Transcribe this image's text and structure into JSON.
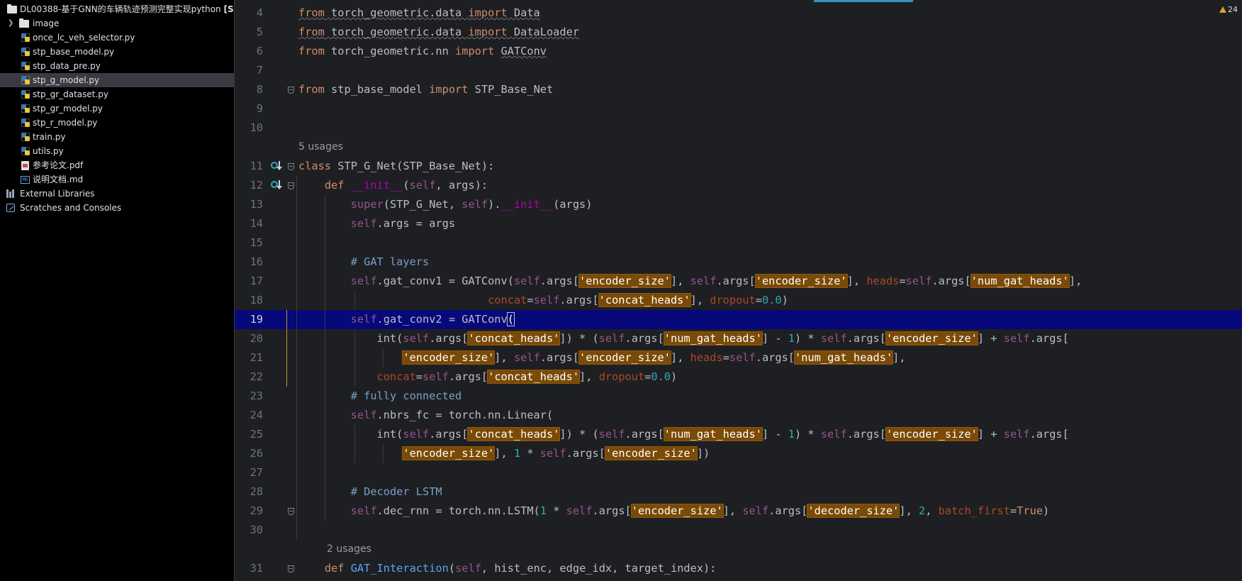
{
  "project_tree": {
    "root": {
      "label": "DL00388-基于GNN的车辆轨迹预测完整实现python",
      "tag": "[SA"
    },
    "items": [
      {
        "label": "image",
        "type": "folder"
      },
      {
        "label": "once_lc_veh_selector.py",
        "type": "py"
      },
      {
        "label": "stp_base_model.py",
        "type": "py"
      },
      {
        "label": "stp_data_pre.py",
        "type": "py"
      },
      {
        "label": "stp_g_model.py",
        "type": "py",
        "selected": true
      },
      {
        "label": "stp_gr_dataset.py",
        "type": "py"
      },
      {
        "label": "stp_gr_model.py",
        "type": "py"
      },
      {
        "label": "stp_r_model.py",
        "type": "py"
      },
      {
        "label": "train.py",
        "type": "py"
      },
      {
        "label": "utils.py",
        "type": "py"
      },
      {
        "label": "参考论文.pdf",
        "type": "pdf"
      },
      {
        "label": "说明文档.md",
        "type": "md"
      }
    ],
    "external_libraries": "External Libraries",
    "scratches": "Scratches and Consoles"
  },
  "editor": {
    "warnings_count": "24",
    "usages_class": "5 usages",
    "usages_method": "2 usages",
    "current_line": 19,
    "lines": [
      {
        "n": "4",
        "t": [
          [
            "kw wavy",
            "from"
          ],
          [
            "wavy",
            " torch_geometric.data "
          ],
          [
            "kw wavy",
            "import"
          ],
          [
            "wavy",
            " Data"
          ]
        ]
      },
      {
        "n": "5",
        "t": [
          [
            "kw wavy",
            "from"
          ],
          [
            "wavy",
            " torch_geometric.data "
          ],
          [
            "kw wavy",
            "import"
          ],
          [
            "wavy",
            " DataLoader"
          ]
        ]
      },
      {
        "n": "6",
        "t": [
          [
            "kw",
            "from"
          ],
          [
            "",
            " torch_geometric.nn "
          ],
          [
            "kw",
            "import"
          ],
          [
            "",
            " "
          ],
          [
            "wavy",
            "GATConv"
          ]
        ]
      },
      {
        "n": "7",
        "t": []
      },
      {
        "n": "8",
        "t": [
          [
            "kw",
            "from"
          ],
          [
            "",
            " stp_base_model "
          ],
          [
            "kw",
            "import"
          ],
          [
            "",
            " STP_Base_Net"
          ]
        ]
      },
      {
        "n": "9",
        "t": []
      },
      {
        "n": "10",
        "t": []
      },
      {
        "n": "11",
        "t": [
          [
            "kw",
            "class"
          ],
          [
            "",
            " STP_G_Net(STP_Base_Net):"
          ]
        ]
      },
      {
        "n": "12",
        "t": [
          [
            "",
            "    "
          ],
          [
            "kw",
            "def"
          ],
          [
            "",
            " "
          ],
          [
            "dd",
            "__init__"
          ],
          [
            "",
            "("
          ],
          [
            "sf",
            "self"
          ],
          [
            "",
            ", args):"
          ]
        ]
      },
      {
        "n": "13",
        "t": [
          [
            "",
            "        "
          ],
          [
            "sf",
            "super"
          ],
          [
            "",
            "(STP_G_Net, "
          ],
          [
            "sf",
            "self"
          ],
          [
            "",
            ")."
          ],
          [
            "dd",
            "__init__"
          ],
          [
            "",
            "(args)"
          ]
        ]
      },
      {
        "n": "14",
        "t": [
          [
            "",
            "        "
          ],
          [
            "sf",
            "self"
          ],
          [
            "",
            ".args = args"
          ]
        ]
      },
      {
        "n": "15",
        "t": []
      },
      {
        "n": "16",
        "t": [
          [
            "",
            "        "
          ],
          [
            "cm",
            "# GAT layers"
          ]
        ]
      },
      {
        "n": "17",
        "t": [
          [
            "",
            "        "
          ],
          [
            "sf",
            "self"
          ],
          [
            "",
            ".gat_conv1 = GATConv("
          ],
          [
            "sf",
            "self"
          ],
          [
            "",
            ".args["
          ],
          [
            "st",
            "'encoder_size'"
          ],
          [
            "",
            "], "
          ],
          [
            "sf",
            "self"
          ],
          [
            "",
            ".args["
          ],
          [
            "st",
            "'encoder_size'"
          ],
          [
            "",
            "], "
          ],
          [
            "pr",
            "heads"
          ],
          [
            "",
            "="
          ],
          [
            "sf",
            "self"
          ],
          [
            "",
            ".args["
          ],
          [
            "st",
            "'num_gat_heads'"
          ],
          [
            "",
            "],"
          ]
        ]
      },
      {
        "n": "18",
        "t": [
          [
            "",
            "                             "
          ],
          [
            "pr",
            "concat"
          ],
          [
            "",
            "="
          ],
          [
            "sf",
            "self"
          ],
          [
            "",
            ".args["
          ],
          [
            "st",
            "'concat_heads'"
          ],
          [
            "",
            "], "
          ],
          [
            "pr",
            "dropout"
          ],
          [
            "",
            "="
          ],
          [
            "nm",
            "0.0"
          ],
          [
            "",
            ")"
          ]
        ]
      },
      {
        "n": "19",
        "t": [
          [
            "",
            "        "
          ],
          [
            "sf",
            "self"
          ],
          [
            "",
            ".gat_conv2 = GATConv"
          ],
          [
            "bracket-match",
            "("
          ]
        ]
      },
      {
        "n": "20",
        "t": [
          [
            "",
            "            int("
          ],
          [
            "sf",
            "self"
          ],
          [
            "",
            ".args["
          ],
          [
            "st",
            "'concat_heads'"
          ],
          [
            "",
            "]) * ("
          ],
          [
            "sf",
            "self"
          ],
          [
            "",
            ".args["
          ],
          [
            "st",
            "'num_gat_heads'"
          ],
          [
            "",
            "] - "
          ],
          [
            "nm",
            "1"
          ],
          [
            "",
            ") * "
          ],
          [
            "sf",
            "self"
          ],
          [
            "",
            ".args["
          ],
          [
            "st",
            "'encoder_size'"
          ],
          [
            "",
            "] + "
          ],
          [
            "sf",
            "self"
          ],
          [
            "",
            ".args["
          ]
        ]
      },
      {
        "n": "21",
        "t": [
          [
            "",
            "                "
          ],
          [
            "st",
            "'encoder_size'"
          ],
          [
            "",
            "], "
          ],
          [
            "sf",
            "self"
          ],
          [
            "",
            ".args["
          ],
          [
            "st",
            "'encoder_size'"
          ],
          [
            "",
            "], "
          ],
          [
            "pr",
            "heads"
          ],
          [
            "",
            "="
          ],
          [
            "sf",
            "self"
          ],
          [
            "",
            ".args["
          ],
          [
            "st",
            "'num_gat_heads'"
          ],
          [
            "",
            "],"
          ]
        ]
      },
      {
        "n": "22",
        "t": [
          [
            "",
            "            "
          ],
          [
            "pr",
            "concat"
          ],
          [
            "",
            "="
          ],
          [
            "sf",
            "self"
          ],
          [
            "",
            ".args["
          ],
          [
            "st",
            "'concat_heads'"
          ],
          [
            "",
            "], "
          ],
          [
            "pr",
            "dropout"
          ],
          [
            "",
            "="
          ],
          [
            "nm",
            "0.0"
          ],
          [
            "",
            ")"
          ]
        ]
      },
      {
        "n": "23",
        "t": [
          [
            "",
            "        "
          ],
          [
            "cm",
            "# fully connected"
          ]
        ]
      },
      {
        "n": "24",
        "t": [
          [
            "",
            "        "
          ],
          [
            "sf",
            "self"
          ],
          [
            "",
            ".nbrs_fc = torch.nn.Linear("
          ]
        ]
      },
      {
        "n": "25",
        "t": [
          [
            "",
            "            int("
          ],
          [
            "sf",
            "self"
          ],
          [
            "",
            ".args["
          ],
          [
            "st",
            "'concat_heads'"
          ],
          [
            "",
            "]) * ("
          ],
          [
            "sf",
            "self"
          ],
          [
            "",
            ".args["
          ],
          [
            "st",
            "'num_gat_heads'"
          ],
          [
            "",
            "] - "
          ],
          [
            "nm",
            "1"
          ],
          [
            "",
            ") * "
          ],
          [
            "sf",
            "self"
          ],
          [
            "",
            ".args["
          ],
          [
            "st",
            "'encoder_size'"
          ],
          [
            "",
            "] + "
          ],
          [
            "sf",
            "self"
          ],
          [
            "",
            ".args["
          ]
        ]
      },
      {
        "n": "26",
        "t": [
          [
            "",
            "                "
          ],
          [
            "st",
            "'encoder_size'"
          ],
          [
            "",
            "], "
          ],
          [
            "nm",
            "1"
          ],
          [
            "",
            " * "
          ],
          [
            "sf",
            "self"
          ],
          [
            "",
            ".args["
          ],
          [
            "st",
            "'encoder_size'"
          ],
          [
            "",
            "])"
          ]
        ]
      },
      {
        "n": "27",
        "t": []
      },
      {
        "n": "28",
        "t": [
          [
            "",
            "        "
          ],
          [
            "cm",
            "# Decoder LSTM"
          ]
        ]
      },
      {
        "n": "29",
        "t": [
          [
            "",
            "        "
          ],
          [
            "sf",
            "self"
          ],
          [
            "",
            ".dec_rnn = torch.nn.LSTM("
          ],
          [
            "nm",
            "1"
          ],
          [
            "",
            " * "
          ],
          [
            "sf",
            "self"
          ],
          [
            "",
            ".args["
          ],
          [
            "st",
            "'encoder_size'"
          ],
          [
            "",
            "], "
          ],
          [
            "sf",
            "self"
          ],
          [
            "",
            ".args["
          ],
          [
            "st",
            "'decoder_size'"
          ],
          [
            "",
            "], "
          ],
          [
            "nm",
            "2"
          ],
          [
            "",
            ", "
          ],
          [
            "pr",
            "batch_first"
          ],
          [
            "",
            "="
          ],
          [
            "kw",
            "True"
          ],
          [
            "",
            ")"
          ]
        ]
      },
      {
        "n": "30",
        "t": []
      },
      {
        "n": "31",
        "t": [
          [
            "",
            "    "
          ],
          [
            "kw",
            "def"
          ],
          [
            "",
            " "
          ],
          [
            "fn",
            "GAT_Interaction"
          ],
          [
            "",
            "("
          ],
          [
            "sf",
            "self"
          ],
          [
            "",
            ", hist_enc, edge_idx, target_index):"
          ]
        ]
      }
    ]
  },
  "colors": {
    "keyword": "#cf8e6d",
    "self": "#94558d",
    "string_highlight_bg": "#7a4a06",
    "current_line_bg": "#07087a",
    "number": "#2aacb8",
    "comment": "#7a9fc9"
  }
}
